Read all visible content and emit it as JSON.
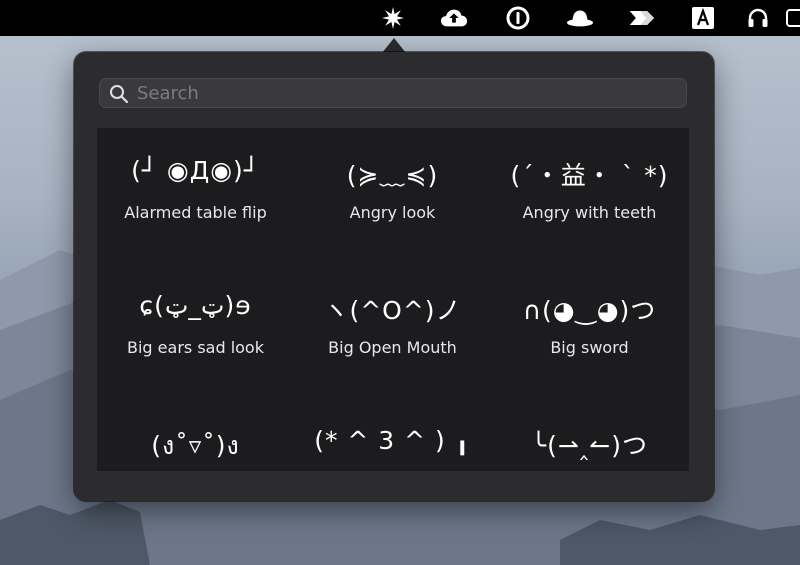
{
  "search": {
    "placeholder": "Search",
    "value": ""
  },
  "emoticons": [
    {
      "kaomoji": "(┘ ◉Д◉)┘",
      "name": "Alarmed table flip"
    },
    {
      "kaomoji": "(≽﹏≼)",
      "name": "Angry look"
    },
    {
      "kaomoji": "(´・益・ ` *)",
      "name": "Angry with teeth"
    },
    {
      "kaomoji": "ɕ(ټ_ټ)ɘ",
      "name": "Big ears sad look"
    },
    {
      "kaomoji": "ヽ(^O^)ノ",
      "name": "Big Open Mouth"
    },
    {
      "kaomoji": "∩(◕‿◕)つ",
      "name": "Big sword"
    },
    {
      "kaomoji": "(ง˚▿˚)ง",
      "name": ""
    },
    {
      "kaomoji": "(* ^ 3 ^ ) ╻",
      "name": ""
    },
    {
      "kaomoji": "╰(⇀‸↼)つ",
      "name": ""
    }
  ],
  "menubar_icons": [
    "sparkle-icon",
    "cloud-upload-icon",
    "1password-icon",
    "hat-icon",
    "arrows-icon",
    "letter-a-icon",
    "headphones-icon",
    "battery-icon"
  ],
  "colors": {
    "popover_bg": "#2c2c2e",
    "grid_bg": "#1c1c1e",
    "menubar_bg": "#000000"
  }
}
